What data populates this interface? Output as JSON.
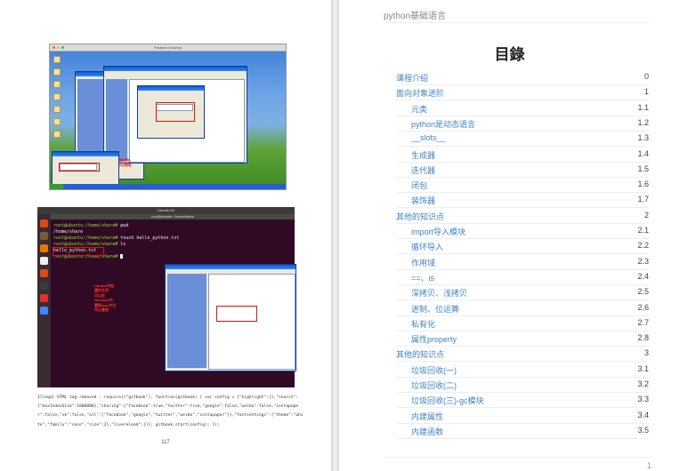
{
  "left_page": {
    "screenshot_xp": {
      "window_title": "Parallels Desktop",
      "note": "格式为:\n\\\\ip地址"
    },
    "screenshot_ubuntu": {
      "window_title": "Ubuntu 64",
      "terminal_title": "root@ubuntu: /home/share",
      "terminal_lines": [
        {
          "prompt": "root@ubuntu:/home/share#",
          "cmd": " pwd"
        },
        {
          "prompt": "",
          "cmd": "/home/share"
        },
        {
          "prompt": "root@ubuntu:/home/share#",
          "cmd": " touch hello_python.txt"
        },
        {
          "prompt": "root@ubuntu:/home/share#",
          "cmd": " ls"
        },
        {
          "prompt": "",
          "cmd": "hello_python.txt"
        },
        {
          "prompt": "root@ubuntu:/home/share#",
          "cmd": " "
        }
      ],
      "note": "Ubuntu中创\n建的文件,\n可以在\nwindows中\n看到mac中也\n可以看到"
    },
    "caption": "Illegal HTML tag removed : require([\"gitbook\"], function(gitbook) { var config = {\"highlight\":{},\"search\":{\"maxIndexSize\":1000000},\"sharing\":{\"facebook\":true,\"twitter\":true,\"google\":false,\"weibo\":false,\"instapaper\":false,\"vk\":false,\"all\":[\"facebook\",\"google\",\"twitter\",\"weibo\",\"instapaper\"]},\"fontsettings\":{\"theme\":\"white\",\"family\":\"sans\",\"size\":2},\"livereload\":{}}; gitbook.start(config); });",
    "page_number": "117"
  },
  "right_page": {
    "header": "python基础语言",
    "toc_title": "目錄",
    "toc": [
      {
        "label": "课程介绍",
        "num": "0",
        "level": 0
      },
      {
        "label": "面向对象进阶",
        "num": "1",
        "level": 0
      },
      {
        "label": "元类",
        "num": "1.1",
        "level": 1
      },
      {
        "label": "python是动态语言",
        "num": "1.2",
        "level": 1
      },
      {
        "label": "__slots__",
        "num": "1.3",
        "level": 1
      },
      {
        "label": "生成器",
        "num": "1.4",
        "level": 1
      },
      {
        "label": "迭代器",
        "num": "1.5",
        "level": 1
      },
      {
        "label": "闭包",
        "num": "1.6",
        "level": 1
      },
      {
        "label": "装饰器",
        "num": "1.7",
        "level": 1
      },
      {
        "label": "其他的知识点",
        "num": "2",
        "level": 0
      },
      {
        "label": "import导入模块",
        "num": "2.1",
        "level": 1
      },
      {
        "label": "循环导入",
        "num": "2.2",
        "level": 1
      },
      {
        "label": "作用域",
        "num": "2.3",
        "level": 1
      },
      {
        "label": "==、is",
        "num": "2.4",
        "level": 1
      },
      {
        "label": "深拷贝、浅拷贝",
        "num": "2.5",
        "level": 1
      },
      {
        "label": "进制、位运算",
        "num": "2.6",
        "level": 1
      },
      {
        "label": "私有化",
        "num": "2.7",
        "level": 1
      },
      {
        "label": "属性property",
        "num": "2.8",
        "level": 1
      },
      {
        "label": "其他的知识点",
        "num": "3",
        "level": 0
      },
      {
        "label": "垃圾回收(一)",
        "num": "3.1",
        "level": 1
      },
      {
        "label": "垃圾回收(二)",
        "num": "3.2",
        "level": 1
      },
      {
        "label": "垃圾回收(三)-gc模块",
        "num": "3.3",
        "level": 1
      },
      {
        "label": "内建属性",
        "num": "3.4",
        "level": 1
      },
      {
        "label": "内建函数",
        "num": "3.5",
        "level": 1
      }
    ],
    "page_number": "1"
  }
}
